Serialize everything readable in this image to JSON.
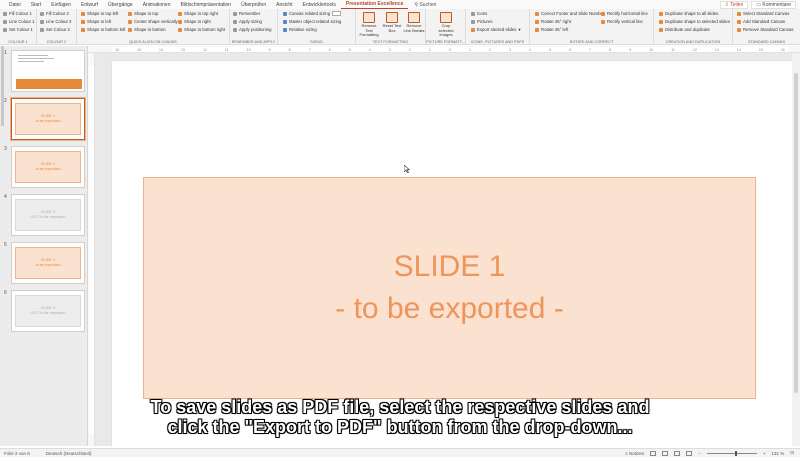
{
  "menu": {
    "tabs": [
      "Datei",
      "Start",
      "Einfügen",
      "Entwurf",
      "Übergänge",
      "Animationen",
      "Bildschirmpräsentation",
      "Überprüfen",
      "Ansicht",
      "Entwicklertools",
      "Presentation Excellence"
    ],
    "search": "Suchen",
    "share": "Teilen",
    "comments": "Kommentare"
  },
  "ribbon": {
    "colour1": {
      "items": [
        "Fill Colour 1",
        "Line Colour 1",
        "Set Colour 1"
      ],
      "label": "COLOUR 1"
    },
    "colour2": {
      "items": [
        "Fill Colour 2",
        "Line Colour 2",
        "Set Colour 2"
      ],
      "label": "COLOUR 2"
    },
    "align": {
      "col1": [
        "Shape to top left",
        "Shape to left",
        "Shape to bottom left"
      ],
      "col2": [
        "Shape to top",
        "Center shape vertically",
        "Shape to bottom"
      ],
      "col3": [
        "Shape to top right",
        "Shape to right",
        "Shape to bottom right"
      ],
      "label": "QUICK ALIGN ON CANVAS"
    },
    "remember": {
      "items": [
        "Remember",
        "Apply sizing",
        "Apply positioning"
      ],
      "label": "REMEMBER AND APPLY"
    },
    "sizing": {
      "items": [
        "Canvas related sizing",
        "Master object related sizing",
        "Relative sizing"
      ],
      "label": "SIZING"
    },
    "textfmt": {
      "buttons": [
        "Remove Text Formatting",
        "Reset Text Box",
        "Remove Line Breaks"
      ],
      "label": "TEXT FORMATTING"
    },
    "picture": {
      "button": "Crop selected images",
      "label": "PICTURE FORMATT..."
    },
    "icons": {
      "items": [
        "Icons",
        "Pictures",
        "Export slected slides"
      ],
      "label": "ICONS, PICTURES AND PDFS"
    },
    "rotate": {
      "col1": [
        "Correct Footer and Slide Number",
        "Rotate 45° right",
        "Rotate 45° left"
      ],
      "col2": [
        "Rectify horizontal line",
        "Rectify vertical line"
      ],
      "label": "ROTATE AND CORRECT"
    },
    "creation": {
      "items": [
        "Duplicate shape to all slides",
        "Duplicate shape to selected slides",
        "Distribute and duplicate"
      ],
      "label": "CREATION AND DUPLICATION"
    },
    "canvas": {
      "items": [
        "Select Standard Canvas",
        "Add Standard Canvas",
        "Remove Standard Canvas"
      ],
      "label": "STANDARD CANVAS"
    }
  },
  "ruler": {
    "ticks": [
      "16",
      "15",
      "14",
      "13",
      "12",
      "11",
      "10",
      "9",
      "8",
      "7",
      "6",
      "5",
      "4",
      "3",
      "2",
      "1",
      "0",
      "1",
      "2",
      "3",
      "4",
      "5",
      "6",
      "7",
      "8",
      "9",
      "10",
      "11",
      "12",
      "13",
      "14",
      "15",
      "16"
    ]
  },
  "slides": [
    {
      "num": "1"
    },
    {
      "num": "2",
      "line1": "SLIDE 1",
      "line2": "- to be exported -"
    },
    {
      "num": "3",
      "line1": "SLIDE 2",
      "line2": "- to be exported -"
    },
    {
      "num": "4",
      "line1": "SLIDE 3",
      "line2": "- NOT to be exported -"
    },
    {
      "num": "5",
      "line1": "SLIDE 4",
      "line2": "- to be exported -"
    },
    {
      "num": "6",
      "line1": "SLIDE 5",
      "line2": "- NOT to be exported -"
    }
  ],
  "main_slide": {
    "title": "SLIDE 1",
    "subtitle": "- to be exported -"
  },
  "caption": {
    "line1": "To save slides as PDF file, select the respective slides and",
    "line2": "click the \"Export to PDF\" button from the drop-down..."
  },
  "status": {
    "slide": "Folie 2 von 6",
    "language": "Deutsch (Deutschland)",
    "notes": "Notizen",
    "zoom": "131 %"
  }
}
